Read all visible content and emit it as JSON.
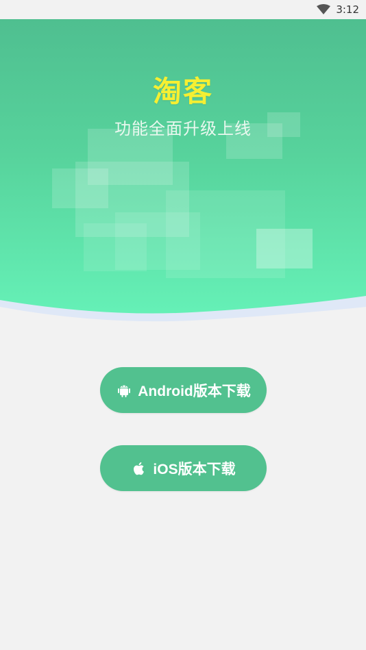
{
  "status_bar": {
    "time": "3:12",
    "wifi_icon": "wifi-icon"
  },
  "hero": {
    "title": "淘客",
    "subtitle": "功能全面升级上线",
    "title_color": "#f5ef32",
    "gradient_top": "#4fbf90",
    "gradient_bottom": "#66f2b8"
  },
  "buttons": {
    "android": {
      "label": "Android版本下载",
      "icon": "android-icon"
    },
    "ios": {
      "label": "iOS版本下载",
      "icon": "apple-icon"
    },
    "color": "#52c18f"
  }
}
